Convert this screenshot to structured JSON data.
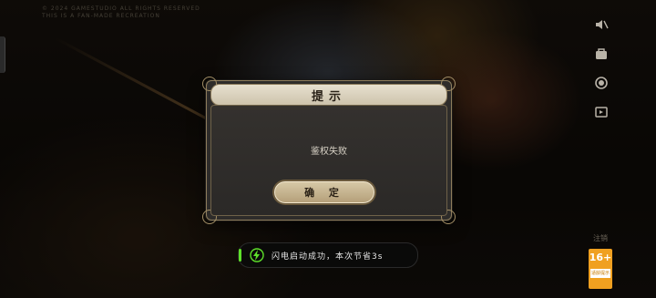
{
  "background": {
    "copyright_line_1": "© 2024 GAMESTUDIO ALL RIGHTS RESERVED",
    "copyright_line_2": "THIS IS A FAN-MADE RECREATION"
  },
  "side_toolbar": {
    "icons": [
      "mute-icon",
      "bag-icon",
      "record-icon",
      "screen-icon"
    ]
  },
  "dialog": {
    "title": "提示",
    "message": "鉴权失败",
    "confirm_label": "确 定"
  },
  "toast": {
    "text": "闪电启动成功，本次节省3s",
    "accent": "#5ee02a"
  },
  "rating": {
    "label": "注销",
    "age": "16+",
    "sub": "适龄提示"
  },
  "colors": {
    "dialog_border": "#8d7c5c",
    "title_bg": "#e7e0cf",
    "button_bg": "#d6c8a6",
    "badge": "#f0a020"
  }
}
